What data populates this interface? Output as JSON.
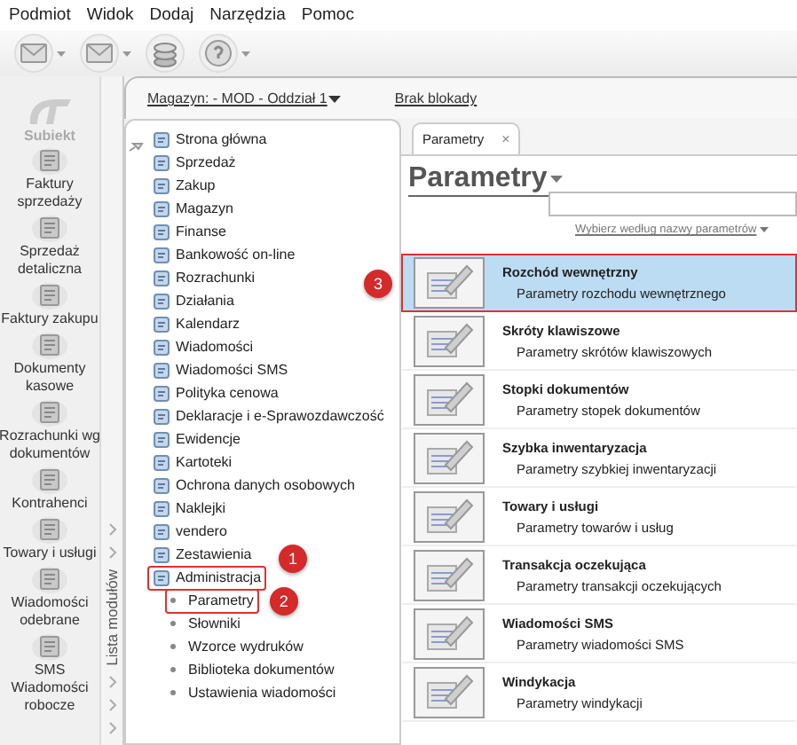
{
  "menu": [
    "Podmiot",
    "Widok",
    "Dodaj",
    "Narzędzia",
    "Pomoc"
  ],
  "toolbar": [
    {
      "kind": "envelope",
      "has_menu": true
    },
    {
      "kind": "envelope",
      "has_menu": true
    },
    {
      "kind": "coins",
      "has_menu": false
    },
    {
      "kind": "help",
      "has_menu": true
    }
  ],
  "logo_label": "Subiekt",
  "shortcuts": [
    {
      "lines": [
        "Faktury",
        "sprzedaży"
      ]
    },
    {
      "lines": [
        "Sprzedaż",
        "detaliczna"
      ]
    },
    {
      "lines": [
        "Faktury zakupu"
      ]
    },
    {
      "lines": [
        "Dokumenty",
        "kasowe"
      ]
    },
    {
      "lines": [
        "Rozrachunki wg",
        "dokumentów"
      ]
    },
    {
      "lines": [
        "Kontrahenci"
      ]
    },
    {
      "lines": [
        "Towary i usługi"
      ]
    },
    {
      "lines": [
        "Wiadomości",
        "odebrane"
      ]
    },
    {
      "lines": [
        "SMS",
        "Wiadomości",
        "robocze"
      ]
    }
  ],
  "module_strip_label": "Lista modułów",
  "header": {
    "warehouse": "Magazyn: - MOD - Oddział 1",
    "lock": "Brak blokady"
  },
  "nav": [
    {
      "label": "Strona główna",
      "outlined": false
    },
    {
      "label": "Sprzedaż",
      "outlined": false
    },
    {
      "label": "Zakup",
      "outlined": false
    },
    {
      "label": "Magazyn",
      "outlined": false
    },
    {
      "label": "Finanse",
      "outlined": false
    },
    {
      "label": "Bankowość on-line",
      "outlined": false
    },
    {
      "label": "Rozrachunki",
      "outlined": false
    },
    {
      "label": "Działania",
      "outlined": false
    },
    {
      "label": "Kalendarz",
      "outlined": false
    },
    {
      "label": "Wiadomości",
      "outlined": false
    },
    {
      "label": "Wiadomości SMS",
      "outlined": false
    },
    {
      "label": "Polityka cenowa",
      "outlined": false
    },
    {
      "label": "Deklaracje i e-Sprawozdawczość",
      "outlined": false
    },
    {
      "label": "Ewidencje",
      "outlined": false
    },
    {
      "label": "Kartoteki",
      "outlined": false
    },
    {
      "label": "Ochrona danych osobowych",
      "outlined": false
    },
    {
      "label": "Naklejki",
      "outlined": false
    },
    {
      "label": "vendero",
      "outlined": false
    },
    {
      "label": "Zestawienia",
      "outlined": false
    },
    {
      "label": "Administracja",
      "outlined": true,
      "callout": "1",
      "children": [
        {
          "label": "Parametry",
          "outlined": true,
          "callout": "2"
        },
        {
          "label": "Słowniki",
          "outlined": false
        },
        {
          "label": "Wzorce wydruków",
          "outlined": false
        },
        {
          "label": "Biblioteka dokumentów",
          "outlined": false
        },
        {
          "label": "Ustawienia wiadomości",
          "outlined": false
        }
      ]
    }
  ],
  "tab": {
    "label": "Parametry",
    "close": "×"
  },
  "title": "Parametry",
  "filter_link": "Wybierz według nazwy parametrów",
  "params": [
    {
      "title": "Rozchód wewnętrzny",
      "subtitle": "Parametry rozchodu wewnętrznego",
      "selected": true,
      "outlined": true,
      "callout": "3"
    },
    {
      "title": "Skróty klawiszowe",
      "subtitle": "Parametry skrótów klawiszowych",
      "selected": false,
      "outlined": false
    },
    {
      "title": "Stopki dokumentów",
      "subtitle": "Parametry stopek dokumentów",
      "selected": false,
      "outlined": false
    },
    {
      "title": "Szybka inwentaryzacja",
      "subtitle": "Parametry szybkiej inwentaryzacji",
      "selected": false,
      "outlined": false
    },
    {
      "title": "Towary i usługi",
      "subtitle": "Parametry towarów i usług",
      "selected": false,
      "outlined": false
    },
    {
      "title": "Transakcja oczekująca",
      "subtitle": "Parametry transakcji oczekujących",
      "selected": false,
      "outlined": false
    },
    {
      "title": "Wiadomości SMS",
      "subtitle": "Parametry wiadomości SMS",
      "selected": false,
      "outlined": false
    },
    {
      "title": "Windykacja",
      "subtitle": "Parametry windykacji",
      "selected": false,
      "outlined": false
    }
  ]
}
